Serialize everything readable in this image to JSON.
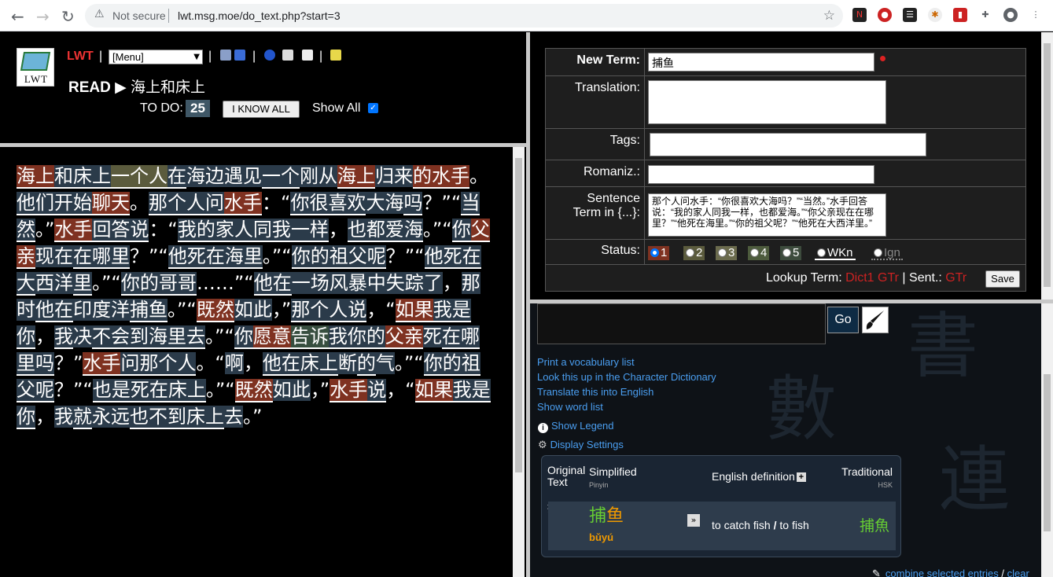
{
  "browser": {
    "security_label": "Not secure",
    "url": "lwt.msg.moe/do_text.php?start=3"
  },
  "header": {
    "logo_text": "LWT",
    "app_name": "LWT",
    "menu_select": "[Menu]",
    "read_label": "READ",
    "read_arrow": "▶",
    "text_title": "海上和床上",
    "todo_label": "TO DO:",
    "todo_count": "25",
    "iknow_button": "I KNOW ALL",
    "show_all_label": "Show All"
  },
  "text_words": [
    {
      "t": "海上",
      "c": "s1 u"
    },
    {
      "t": "和",
      "c": "s0 u"
    },
    {
      "t": "床上",
      "c": "s0 u"
    },
    {
      "t": "一个人",
      "c": "s2 u"
    },
    {
      "t": "在",
      "c": "s0 u"
    },
    {
      "t": "海边",
      "c": "s0"
    },
    {
      "t": "遇见",
      "c": "s0"
    },
    {
      "t": "一个",
      "c": "s0 u"
    },
    {
      "t": "刚",
      "c": "s0"
    },
    {
      "t": "从",
      "c": "s0"
    },
    {
      "t": "海上",
      "c": "s1 u"
    },
    {
      "t": "归",
      "c": "s0"
    },
    {
      "t": "来",
      "c": "s0"
    },
    {
      "t": "的",
      "c": "s1 u"
    },
    {
      "t": "水手",
      "c": "s1 u"
    },
    {
      "t": "。",
      "c": ""
    },
    {
      "t": "他们",
      "c": "s0 u"
    },
    {
      "t": "开始",
      "c": "s0 u"
    },
    {
      "t": "聊天",
      "c": "s1 u"
    },
    {
      "t": "。",
      "c": ""
    },
    {
      "t": "那个人",
      "c": "s0 u"
    },
    {
      "t": "问",
      "c": "s0 u"
    },
    {
      "t": "水手",
      "c": "s1 u"
    },
    {
      "t": "：“",
      "c": ""
    },
    {
      "t": "你",
      "c": "s0 u"
    },
    {
      "t": "很",
      "c": "s0 u"
    },
    {
      "t": "喜欢",
      "c": "s0 u"
    },
    {
      "t": "大海",
      "c": "s0"
    },
    {
      "t": "吗",
      "c": "s0 u"
    },
    {
      "t": "？”“",
      "c": ""
    },
    {
      "t": "当然",
      "c": "s0 u"
    },
    {
      "t": "。”",
      "c": ""
    },
    {
      "t": "水手",
      "c": "s1 u"
    },
    {
      "t": "回答",
      "c": "s0 u"
    },
    {
      "t": "说",
      "c": "s0 u"
    },
    {
      "t": "：“",
      "c": ""
    },
    {
      "t": "我",
      "c": "s0 u"
    },
    {
      "t": "的",
      "c": "s0 u"
    },
    {
      "t": "家人",
      "c": "s0 u"
    },
    {
      "t": "同",
      "c": "s0 u"
    },
    {
      "t": "我",
      "c": "s0 u"
    },
    {
      "t": "一样",
      "c": "s0 u"
    },
    {
      "t": "，",
      "c": ""
    },
    {
      "t": "也",
      "c": "s0 u"
    },
    {
      "t": "都",
      "c": "s0 u"
    },
    {
      "t": "爱",
      "c": "s0 u"
    },
    {
      "t": "海",
      "c": "s0 u"
    },
    {
      "t": "。”“",
      "c": ""
    },
    {
      "t": "你",
      "c": "s0 u"
    },
    {
      "t": "父亲",
      "c": "s1 u"
    },
    {
      "t": "现在",
      "c": "s0"
    },
    {
      "t": "在",
      "c": "s0 u"
    },
    {
      "t": "哪里",
      "c": "s0 u"
    },
    {
      "t": "？”“",
      "c": ""
    },
    {
      "t": "他",
      "c": "s0 u"
    },
    {
      "t": "死",
      "c": "s0 u"
    },
    {
      "t": "在",
      "c": "s0 u"
    },
    {
      "t": "海里",
      "c": "s0 u"
    },
    {
      "t": "。”“",
      "c": ""
    },
    {
      "t": "你",
      "c": "s0 u"
    },
    {
      "t": "的",
      "c": "s0 u"
    },
    {
      "t": "祖父",
      "c": "s0 u"
    },
    {
      "t": "呢",
      "c": "s0 u"
    },
    {
      "t": "？”“",
      "c": ""
    },
    {
      "t": "他",
      "c": "s0 u"
    },
    {
      "t": "死",
      "c": "s0 u"
    },
    {
      "t": "在",
      "c": "s0 u"
    },
    {
      "t": "大",
      "c": "s0 u"
    },
    {
      "t": "西洋",
      "c": "s0"
    },
    {
      "t": "里",
      "c": "s0 u"
    },
    {
      "t": "。”“",
      "c": ""
    },
    {
      "t": "你",
      "c": "s0 u"
    },
    {
      "t": "的",
      "c": "s0 u"
    },
    {
      "t": "哥哥",
      "c": "s0 u"
    },
    {
      "t": "……”“",
      "c": ""
    },
    {
      "t": "他",
      "c": "s0 u"
    },
    {
      "t": "在",
      "c": "s0 u"
    },
    {
      "t": "一场",
      "c": "s0"
    },
    {
      "t": "风暴",
      "c": "s0"
    },
    {
      "t": "中",
      "c": "s0"
    },
    {
      "t": "失踪了",
      "c": "s0"
    },
    {
      "t": "，",
      "c": ""
    },
    {
      "t": "那时",
      "c": "s0"
    },
    {
      "t": "他",
      "c": "s0 u"
    },
    {
      "t": "在",
      "c": "s0 u"
    },
    {
      "t": "印度洋",
      "c": "s0"
    },
    {
      "t": "捕鱼",
      "c": "s0 u"
    },
    {
      "t": "。”“",
      "c": ""
    },
    {
      "t": "既然",
      "c": "s1 u"
    },
    {
      "t": "如此",
      "c": "s0"
    },
    {
      "t": "，”",
      "c": ""
    },
    {
      "t": "那个人",
      "c": "s0 u"
    },
    {
      "t": "说",
      "c": "s0 u"
    },
    {
      "t": "，“",
      "c": ""
    },
    {
      "t": "如果",
      "c": "s1 u"
    },
    {
      "t": "我",
      "c": "s0 u"
    },
    {
      "t": "是",
      "c": "s0 u"
    },
    {
      "t": "你",
      "c": "s0 u"
    },
    {
      "t": "，",
      "c": ""
    },
    {
      "t": "我",
      "c": "s0 u"
    },
    {
      "t": "决",
      "c": "s0"
    },
    {
      "t": "不会",
      "c": "s0 u"
    },
    {
      "t": "到",
      "c": "s0 u"
    },
    {
      "t": "海里",
      "c": "s0 u"
    },
    {
      "t": "去",
      "c": "s0 u"
    },
    {
      "t": "。”“",
      "c": ""
    },
    {
      "t": "你",
      "c": "s0 u"
    },
    {
      "t": "愿意",
      "c": "s1 u"
    },
    {
      "t": "告诉",
      "c": "k u"
    },
    {
      "t": "我",
      "c": "s0 u"
    },
    {
      "t": "你",
      "c": "s0 u"
    },
    {
      "t": "的",
      "c": "s0 u"
    },
    {
      "t": "父亲",
      "c": "s1 u"
    },
    {
      "t": "死",
      "c": "s0"
    },
    {
      "t": "在",
      "c": "s0 u"
    },
    {
      "t": "哪里",
      "c": "s0 u"
    },
    {
      "t": "吗",
      "c": "s0 u"
    },
    {
      "t": "？”",
      "c": ""
    },
    {
      "t": "水手",
      "c": "s1 u"
    },
    {
      "t": "问",
      "c": "s0 u"
    },
    {
      "t": "那个人",
      "c": "s0 u"
    },
    {
      "t": "。“",
      "c": ""
    },
    {
      "t": "啊",
      "c": "s0"
    },
    {
      "t": "，",
      "c": ""
    },
    {
      "t": "他",
      "c": "s0 u"
    },
    {
      "t": "在",
      "c": "s0 u"
    },
    {
      "t": "床上",
      "c": "s0 u"
    },
    {
      "t": "断",
      "c": "s0"
    },
    {
      "t": "的",
      "c": "s0 u"
    },
    {
      "t": "气",
      "c": "s0"
    },
    {
      "t": "。”“",
      "c": ""
    },
    {
      "t": "你",
      "c": "s0 u"
    },
    {
      "t": "的",
      "c": "s0 u"
    },
    {
      "t": "祖父",
      "c": "s0 u"
    },
    {
      "t": "呢",
      "c": "s0 u"
    },
    {
      "t": "？”“",
      "c": ""
    },
    {
      "t": "也",
      "c": "s0 u"
    },
    {
      "t": "是",
      "c": "s0 u"
    },
    {
      "t": "死",
      "c": "s0 u"
    },
    {
      "t": "在",
      "c": "s0 u"
    },
    {
      "t": "床上",
      "c": "s0 u"
    },
    {
      "t": "。”“",
      "c": ""
    },
    {
      "t": "既然",
      "c": "s1 u"
    },
    {
      "t": "如此",
      "c": "s0"
    },
    {
      "t": "，”",
      "c": ""
    },
    {
      "t": "水手",
      "c": "s1 u"
    },
    {
      "t": "说",
      "c": "s0 u"
    },
    {
      "t": "，“",
      "c": ""
    },
    {
      "t": "如果",
      "c": "s1 u"
    },
    {
      "t": "我",
      "c": "s0 u"
    },
    {
      "t": "是",
      "c": "s0 u"
    },
    {
      "t": "你",
      "c": "s0 u"
    },
    {
      "t": "，",
      "c": ""
    },
    {
      "t": "我",
      "c": "s0"
    },
    {
      "t": "就",
      "c": "s0 u"
    },
    {
      "t": "永远",
      "c": "s0"
    },
    {
      "t": "也",
      "c": "s0 u"
    },
    {
      "t": "不",
      "c": "s0 u"
    },
    {
      "t": "到",
      "c": "s0 u"
    },
    {
      "t": "床上",
      "c": "s0 u"
    },
    {
      "t": "去",
      "c": "s0"
    },
    {
      "t": "。”",
      "c": ""
    }
  ],
  "term_form": {
    "new_term_label": "New Term:",
    "new_term_value": "捕鱼",
    "translation_label": "Translation:",
    "tags_label": "Tags:",
    "romaniz_label": "Romaniz.:",
    "sentence_label_1": "Sentence",
    "sentence_label_2": "Term in {...}:",
    "sentence_value": "那个人问水手：“你很喜欢大海吗？”“当然。”水手回答说：“我的家人同我一样，也都爱海。”“你父亲现在在哪里？”“他死在海里。”“你的祖父呢？”“他死在大西洋里。”",
    "status_label": "Status:",
    "status_options": [
      "1",
      "2",
      "3",
      "4",
      "5",
      "WKn",
      "Ign"
    ],
    "status_selected": "1",
    "status_colors": [
      "#7f3221",
      "#5b5b3d",
      "#6b6b4d",
      "#4d5b3d",
      "#3d4b3d",
      "",
      ""
    ],
    "lookup_label": "Lookup Term:",
    "dict1": "Dict1",
    "gtr1": "GTr",
    "pipe": "|",
    "sent_label": "Sent.:",
    "gtr2": "GTr",
    "save_button": "Save"
  },
  "dictionary": {
    "go_button": "Go",
    "links": [
      "Print a vocabulary list",
      "Look this up in the Character Dictionary",
      "Translate this into English",
      "Show word list"
    ],
    "show_legend": "Show Legend",
    "display_settings": "Display Settings",
    "col_original_1": "Original",
    "col_original_2": "Text",
    "col_simplified": "Simplified",
    "col_pinyin": "Pinyin",
    "col_english": "English definition",
    "col_traditional": "Traditional",
    "col_hsk": "HSK",
    "entry_original": "捕鱼",
    "entry_char1": "捕",
    "entry_char2": "鱼",
    "entry_pinyin": "bǔyú",
    "entry_def_1": "to catch fish",
    "entry_def_sep": "/",
    "entry_def_2": "to fish",
    "entry_trad_1": "捕",
    "entry_trad_2": "魚",
    "combine_link": "combine selected entries",
    "slash": "/",
    "clear_link": "clear"
  }
}
